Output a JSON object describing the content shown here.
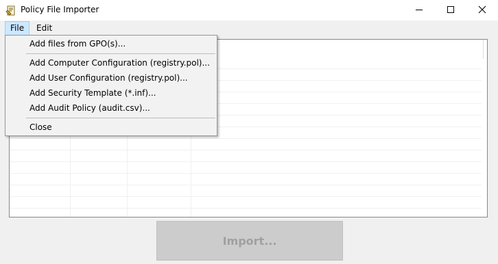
{
  "window": {
    "title": "Policy File Importer"
  },
  "menubar": {
    "file_label": "File",
    "edit_label": "Edit"
  },
  "file_menu": {
    "add_gpo": "Add files from GPO(s)...",
    "add_computer_config": "Add Computer Configuration (registry.pol)...",
    "add_user_config": "Add User Configuration (registry.pol)...",
    "add_security_template": "Add Security Template (*.inf)...",
    "add_audit_policy": "Add Audit Policy (audit.csv)...",
    "close": "Close"
  },
  "import_button": {
    "label": "Import...",
    "enabled": false
  },
  "icons": {
    "app": "policy-file-icon",
    "minimize": "minimize-icon",
    "maximize": "maximize-icon",
    "close": "close-icon"
  }
}
